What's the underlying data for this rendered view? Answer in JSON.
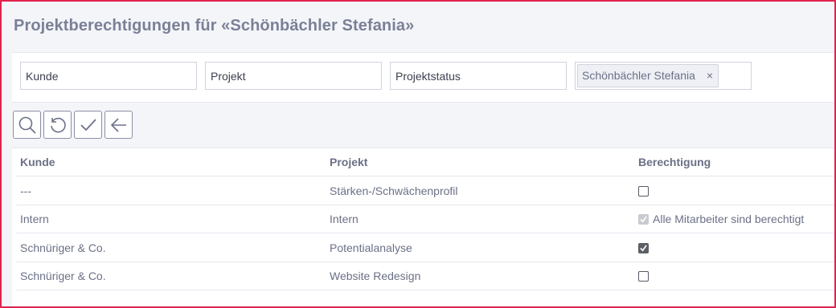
{
  "page": {
    "title": "Projektberechtigungen für «Schönbächler Stefania»"
  },
  "filters": {
    "kunde_placeholder": "Kunde",
    "projekt_placeholder": "Projekt",
    "projektstatus_placeholder": "Projektstatus",
    "employee_tag": "Schönbächler Stefania",
    "tag_remove": "×"
  },
  "toolbar": {
    "icons": [
      "search-icon",
      "reset-icon",
      "check-icon",
      "back-arrow-icon"
    ]
  },
  "table": {
    "headers": {
      "kunde": "Kunde",
      "projekt": "Projekt",
      "berechtigung": "Berechtigung"
    },
    "rows": [
      {
        "kunde": "---",
        "projekt": "Stärken-/Schwächenprofil",
        "checked": false,
        "disabled": false,
        "note": ""
      },
      {
        "kunde": "Intern",
        "projekt": "Intern",
        "checked": true,
        "disabled": true,
        "note": "Alle Mitarbeiter sind berechtigt"
      },
      {
        "kunde": "Schnüriger & Co.",
        "projekt": "Potentialanalyse",
        "checked": true,
        "disabled": false,
        "note": ""
      },
      {
        "kunde": "Schnüriger & Co.",
        "projekt": "Website Redesign",
        "checked": false,
        "disabled": false,
        "note": ""
      }
    ]
  },
  "colors": {
    "border_accent": "#e0234f",
    "background": "#f4f5f9",
    "text": "#6b7086"
  }
}
